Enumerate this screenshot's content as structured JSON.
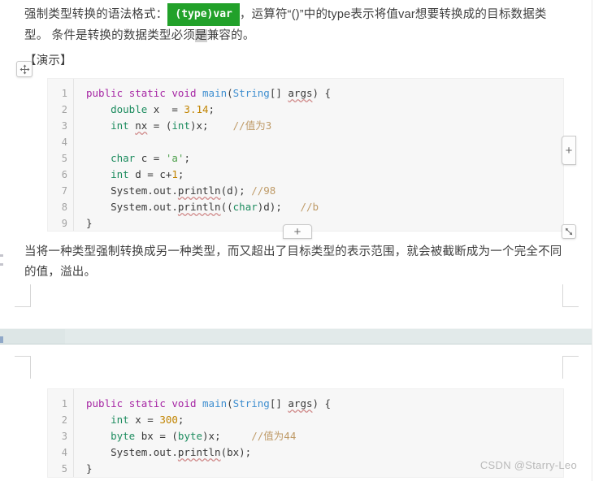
{
  "document": {
    "paragraph_intro_prefix": "强制类型转换的语法格式：",
    "badge_type_cast": "(type)var",
    "paragraph_intro_suffix": "，运算符“()”中的type表示将值var想要转换成的目标数据类型。 条件是转换的数据类型必须",
    "paragraph_intro_selected": "是",
    "paragraph_intro_tail": "兼容的。",
    "paragraph_demo": "【演示】",
    "paragraph_after": "当将一种类型强制转换成另一种类型，而又超出了目标类型的表示范围，就会被截断成为一个完全不同的值，溢出。"
  },
  "code_block_1": {
    "line_numbers": [
      "1",
      "2",
      "3",
      "4",
      "5",
      "6",
      "7",
      "8",
      "9"
    ],
    "lines": [
      "public static void main(String[] args) {",
      "    double x  = 3.14;",
      "    int nx = (int)x;    //值为3",
      "",
      "    char c = 'a';",
      "    int d = c+1;",
      "    System.out.println(d); //98",
      "    System.out.println((char)d);   //b",
      "}"
    ],
    "language": "java"
  },
  "code_block_2": {
    "line_numbers": [
      "1",
      "2",
      "3",
      "4",
      "5"
    ],
    "lines": [
      "public static void main(String[] args) {",
      "    int x = 300;",
      "    byte bx = (byte)x;     //值为44",
      "    System.out.println(bx);",
      "}"
    ],
    "language": "java"
  },
  "controls": {
    "move_handle": "move-handle",
    "add_column_label": "+",
    "add_row_label": "+",
    "resize_handle": "resize-handle"
  },
  "watermark": "CSDN @Starry-Leo",
  "colors": {
    "badge_green": "#22a12a",
    "page_gap": "#e2eaea",
    "code_background": "#f7f7f7",
    "keyword_purple": "#a626a4",
    "type_green": "#1d8c5f",
    "class_blue": "#3f8fd0",
    "number_orange": "#c18401",
    "string_green": "#50a14f",
    "comment_tan": "#bf9b68",
    "watermark_gray": "#b9b9b9"
  }
}
